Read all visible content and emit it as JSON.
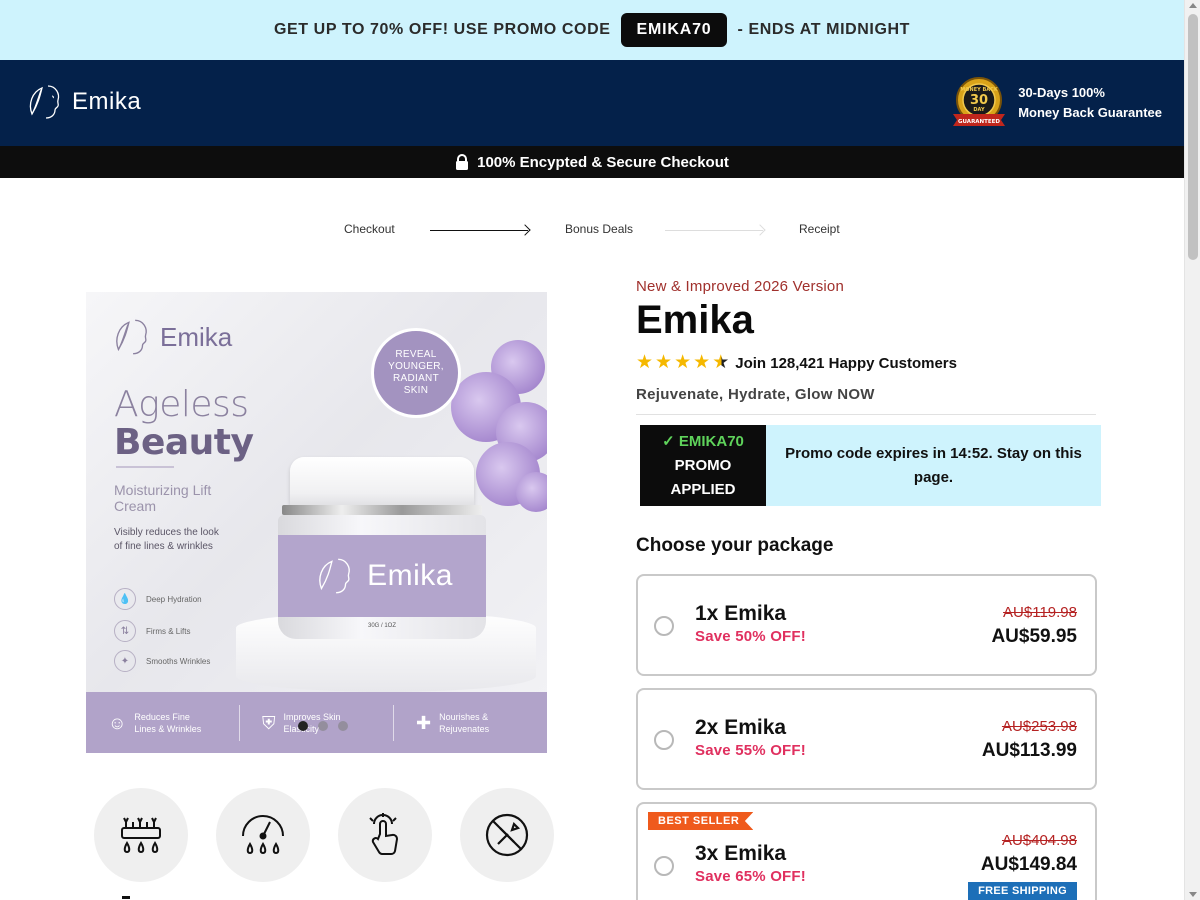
{
  "promo_bar": {
    "before": "GET UP TO 70% OFF! USE PROMO CODE",
    "code": "EMIKA70",
    "after": "- ENDS AT MIDNIGHT"
  },
  "header": {
    "logo": "Emika",
    "guarantee_badge": {
      "top": "MONEY BACK",
      "number": "30",
      "unit": "DAY",
      "ribbon": "GUARANTEED"
    },
    "guarantee_line1": "30-Days 100%",
    "guarantee_line2": "Money Back Guarantee"
  },
  "secure_bar": {
    "text": "100% Encypted & Secure Checkout",
    "icon": "lock-icon"
  },
  "steps": [
    {
      "label": "Checkout",
      "state": "done"
    },
    {
      "label": "Bonus Deals",
      "state": "current"
    },
    {
      "label": "Receipt",
      "state": "upcoming"
    }
  ],
  "product_image": {
    "brand": "Emika",
    "badge": "REVEAL YOUNGER, RADIANT SKIN",
    "headline_light": "Ageless",
    "headline_bold": "Beauty",
    "subhead": "Moisturizing Lift Cream",
    "description": "Visibly reduces the look of fine lines & wrinkles",
    "features": [
      "Deep Hydration",
      "Firms & Lifts",
      "Smooths Wrinkles"
    ],
    "jar_label": "Emika",
    "jar_size": "30G / 1OZ",
    "benefits": [
      "Reduces Fine Lines & Wrinkles",
      "Improves Skin Elasticity",
      "Nourishes & Rejuvenates"
    ],
    "carousel_dots": 3,
    "carousel_active": 1
  },
  "feature_icons": [
    "hydration-icon",
    "firmness-gauge-icon",
    "touch-icon",
    "no-tools-icon"
  ],
  "product": {
    "version": "New & Improved 2026 Version",
    "title": "Emika",
    "rating": 4.5,
    "rating_text": "Join 128,421 Happy Customers",
    "tagline": "Rejuvenate, Hydrate, Glow NOW"
  },
  "promo_box": {
    "check": "✓",
    "code": "EMIKA70",
    "line2": "PROMO",
    "line3": "APPLIED",
    "message": "Promo code expires in 14:52. Stay on this page."
  },
  "choose_label": "Choose your package",
  "packages": [
    {
      "name": "1x Emika",
      "save": "Save 50% OFF!",
      "old_price": "AU$119.98",
      "price": "AU$59.95"
    },
    {
      "name": "2x Emika",
      "save": "Save 55% OFF!",
      "old_price": "AU$253.98",
      "price": "AU$113.99"
    },
    {
      "name": "3x Emika",
      "save": "Save 65% OFF!",
      "old_price": "AU$404.98",
      "price": "AU$149.84",
      "badge": "BEST SELLER",
      "shipping": "FREE SHIPPING"
    }
  ],
  "colors": {
    "promo_bg": "#cef3fd",
    "header_bg": "#04214a",
    "accent_red": "#e0305f",
    "lavender": "#b1a3c9",
    "best_seller": "#ef5a1c",
    "free_shipping": "#1d6fb8"
  }
}
